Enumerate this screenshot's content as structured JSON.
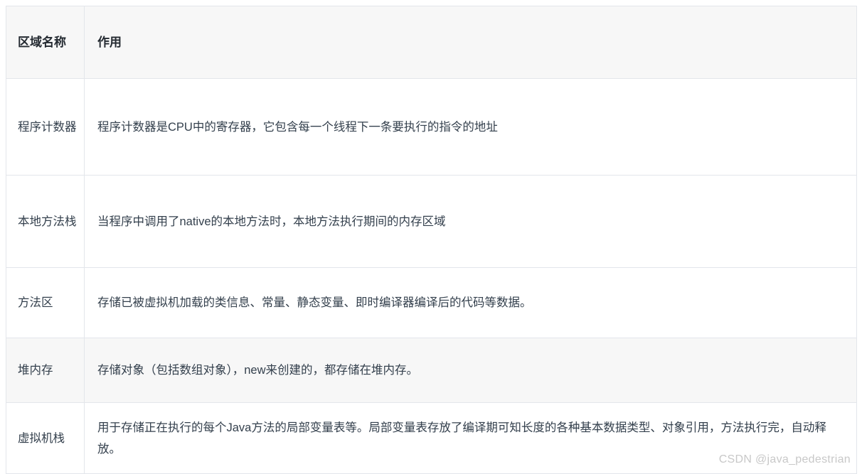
{
  "table": {
    "headers": {
      "name": "区域名称",
      "desc": "作用"
    },
    "rows": [
      {
        "name": "程序计数器",
        "desc": "程序计数器是CPU中的寄存器，它包含每一个线程下一条要执行的指令的地址"
      },
      {
        "name": "本地方法栈",
        "desc": "当程序中调用了native的本地方法时，本地方法执行期间的内存区域"
      },
      {
        "name": "方法区",
        "desc": "存储已被虚拟机加载的类信息、常量、静态变量、即时编译器编译后的代码等数据。"
      },
      {
        "name": "堆内存",
        "desc": "存储对象（包括数组对象），new来创建的，都存储在堆内存。"
      },
      {
        "name": "虚拟机栈",
        "desc": "用于存储正在执行的每个Java方法的局部变量表等。局部变量表存放了编译期可知长度的各种基本数据类型、对象引用，方法执行完，自动释放。"
      }
    ]
  },
  "watermark": {
    "text": "CSDN @java_pedestrian"
  },
  "colors": {
    "header_bg": "#f7f7f7",
    "alt_row_bg": "#f7f7f7",
    "border": "#e3e6eb",
    "text": "#34404d",
    "header_text": "#242a31",
    "watermark": "#c8c8c8"
  }
}
